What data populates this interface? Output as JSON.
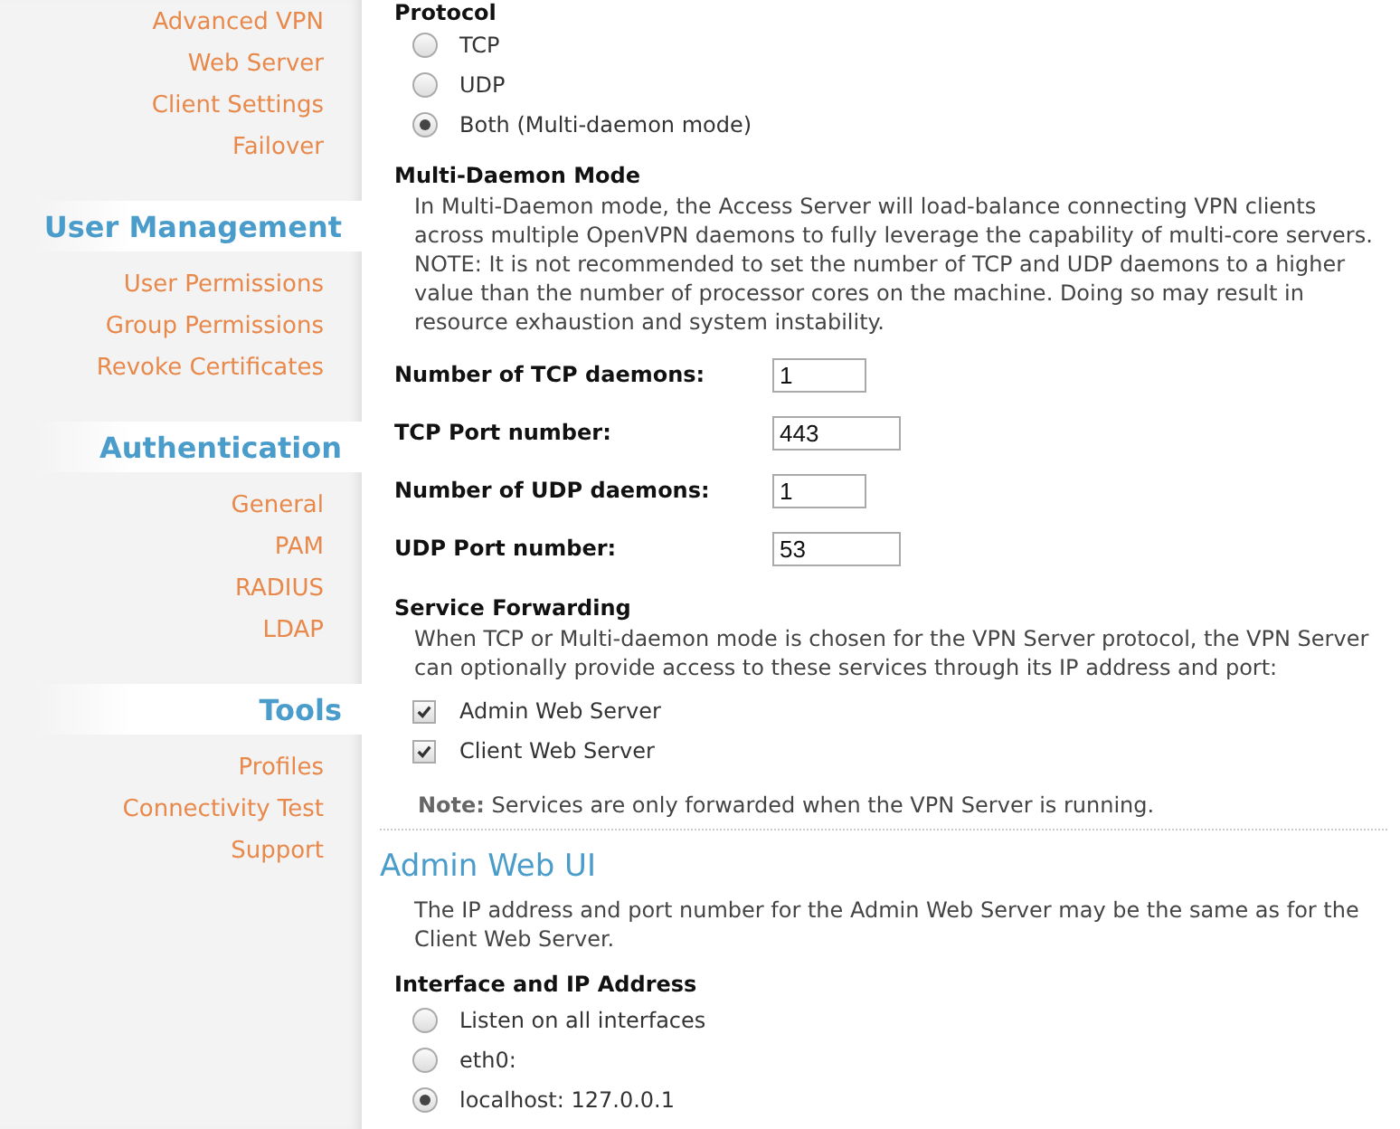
{
  "sidebar": {
    "sections": [
      {
        "items": [
          "Advanced VPN",
          "Web Server",
          "Client Settings",
          "Failover"
        ]
      },
      {
        "title": "User Management",
        "items": [
          "User Permissions",
          "Group Permissions",
          "Revoke Certificates"
        ]
      },
      {
        "title": "Authentication",
        "items": [
          "General",
          "PAM",
          "RADIUS",
          "LDAP"
        ]
      },
      {
        "title": "Tools",
        "items": [
          "Profiles",
          "Connectivity Test",
          "Support"
        ]
      }
    ]
  },
  "protocol": {
    "title": "Protocol",
    "options": [
      {
        "label": "TCP",
        "selected": false
      },
      {
        "label": "UDP",
        "selected": false
      },
      {
        "label": "Both (Multi-daemon mode)",
        "selected": true
      }
    ]
  },
  "multi_daemon": {
    "title": "Multi-Daemon Mode",
    "text": "In Multi-Daemon mode, the Access Server will load-balance connecting VPN clients across multiple OpenVPN daemons to fully leverage the capability of multi-core servers. NOTE: It is not recommended to set the number of TCP and UDP daemons to a higher value than the number of processor cores on the machine. Doing so may result in resource exhaustion and system instability.",
    "fields": [
      {
        "label": "Number of TCP daemons:",
        "value": "1",
        "kind": "count"
      },
      {
        "label": "TCP Port number:",
        "value": "443",
        "kind": "port"
      },
      {
        "label": "Number of UDP daemons:",
        "value": "1",
        "kind": "count"
      },
      {
        "label": "UDP Port number:",
        "value": "53",
        "kind": "port"
      }
    ]
  },
  "service_forwarding": {
    "title": "Service Forwarding",
    "text": "When TCP or Multi-daemon mode is chosen for the VPN Server protocol, the VPN Server can optionally provide access to these services through its IP address and port:",
    "options": [
      {
        "label": "Admin Web Server",
        "checked": true
      },
      {
        "label": "Client Web Server",
        "checked": true
      }
    ],
    "note": "**Note:** Services are only forwarded when the VPN Server is running."
  },
  "admin_web_ui": {
    "title": "Admin Web UI",
    "text": "The IP address and port number for the Admin Web Server may be the same as for the Client Web Server.",
    "interface": {
      "title": "Interface and IP Address",
      "options": [
        {
          "label": "Listen on all interfaces",
          "selected": false
        },
        {
          "label": "eth0:",
          "selected": false
        },
        {
          "label": "localhost: 127.0.0.1",
          "selected": true
        }
      ]
    }
  }
}
